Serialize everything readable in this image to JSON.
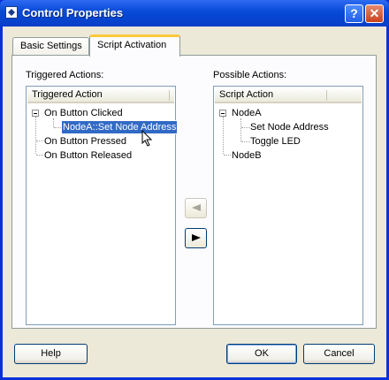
{
  "window": {
    "title": "Control Properties"
  },
  "titlebar_buttons": {
    "help": "?",
    "close": "✕"
  },
  "tabs": [
    {
      "label": "Basic Settings",
      "active": false
    },
    {
      "label": "Script Activation",
      "active": true
    }
  ],
  "triggered": {
    "caption": "Triggered Actions:",
    "column_header": "Triggered Action",
    "items": [
      {
        "label": "On Button Clicked",
        "expanded": true
      },
      {
        "label": "NodeA::Set Node Address",
        "selected": true
      },
      {
        "label": "On Button Pressed"
      },
      {
        "label": "On Button Released"
      }
    ]
  },
  "possible": {
    "caption": "Possible Actions:",
    "column_header": "Script Action",
    "items": [
      {
        "label": "NodeA",
        "expanded": true
      },
      {
        "label": "Set Node Address"
      },
      {
        "label": "Toggle LED"
      },
      {
        "label": "NodeB"
      }
    ]
  },
  "arrow_buttons": {
    "add_icon": "arrow-left-icon",
    "remove_icon": "arrow-right-icon"
  },
  "buttons": {
    "help": "Help",
    "ok": "OK",
    "cancel": "Cancel"
  },
  "colors": {
    "titlebar": "#0a4bd9",
    "dialog_bg": "#ece9d8",
    "selection": "#316ac5",
    "active_tab_accent": "#ffc83c"
  }
}
